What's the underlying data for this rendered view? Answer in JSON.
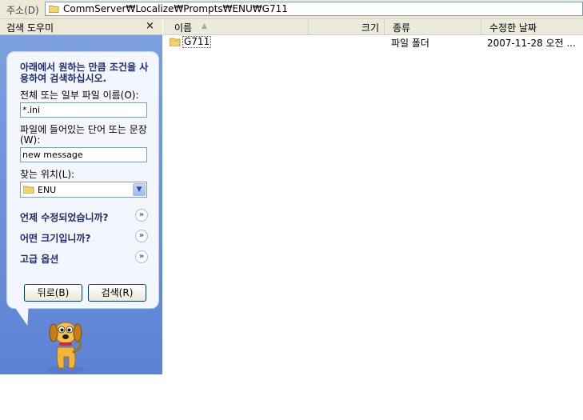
{
  "address_bar": {
    "label": "주소(D)",
    "path": "CommServer₩Localize₩Prompts₩ENU₩G711"
  },
  "search_pane": {
    "title": "검색 도우미",
    "close": "×",
    "instruction": "아래에서 원하는 만큼 조건을 사용하여 검색하십시오.",
    "filename_label": "전체 또는 일부 파일 이름(O):",
    "filename_value": "*.ini",
    "phrase_label": "파일에 들어있는 단어 또는 문장(W):",
    "phrase_value": "new message",
    "location_label": "찾는 위치(L):",
    "location_value": "ENU",
    "options": [
      {
        "label": "언제 수정되었습니까?"
      },
      {
        "label": "어떤 크기입니까?"
      },
      {
        "label": "고급 옵션"
      }
    ],
    "back_button": "뒤로(B)",
    "search_button": "검색(R)"
  },
  "file_list": {
    "columns": {
      "name": "이름",
      "sort_arrow": "▲",
      "size": "크기",
      "type": "종류",
      "modified": "수정한 날짜"
    },
    "rows": [
      {
        "name": "G711",
        "size": "",
        "type": "파일 폴더",
        "modified": "2007-11-28 오전 ..."
      }
    ]
  },
  "colors": {
    "pane_blue": "#6a8ed8",
    "panel_bg": "#f3f6fd",
    "heading_text": "#1d2c6f"
  }
}
